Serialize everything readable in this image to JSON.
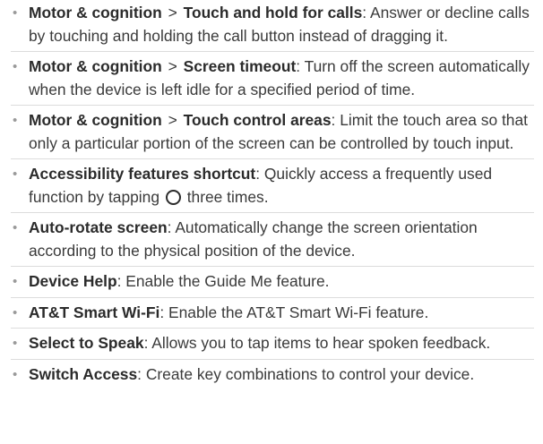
{
  "items": [
    {
      "path": "Motor & cognition",
      "sep": ">",
      "term": "Touch and hold for calls",
      "desc": ": Answer or decline calls by touching and holding the call button instead of dragging it."
    },
    {
      "path": "Motor & cognition",
      "sep": ">",
      "term": "Screen timeout",
      "desc": ": Turn off the screen automatically when the device is left idle for a specified period of time."
    },
    {
      "path": "Motor & cognition",
      "sep": ">",
      "term": "Touch control areas",
      "desc": ": Limit the touch area so that only a particular portion of the screen can be controlled by touch input."
    },
    {
      "term": "Accessibility features shortcut",
      "desc_before": ": Quickly access a frequently used function by tapping",
      "icon": "home-button-icon",
      "desc_after": "three times."
    },
    {
      "term": "Auto-rotate screen",
      "desc": ": Automatically change the screen orientation according to the physical position of the device."
    },
    {
      "term": "Device Help",
      "desc": ": Enable the Guide Me feature."
    },
    {
      "term": "AT&T Smart Wi-Fi",
      "desc": ": Enable the AT&T Smart Wi-Fi feature."
    },
    {
      "term": "Select to Speak",
      "desc": ": Allows you to tap items to hear spoken feedback."
    },
    {
      "term": "Switch Access",
      "desc": ": Create key combinations to control your device."
    }
  ],
  "bullet": "•"
}
